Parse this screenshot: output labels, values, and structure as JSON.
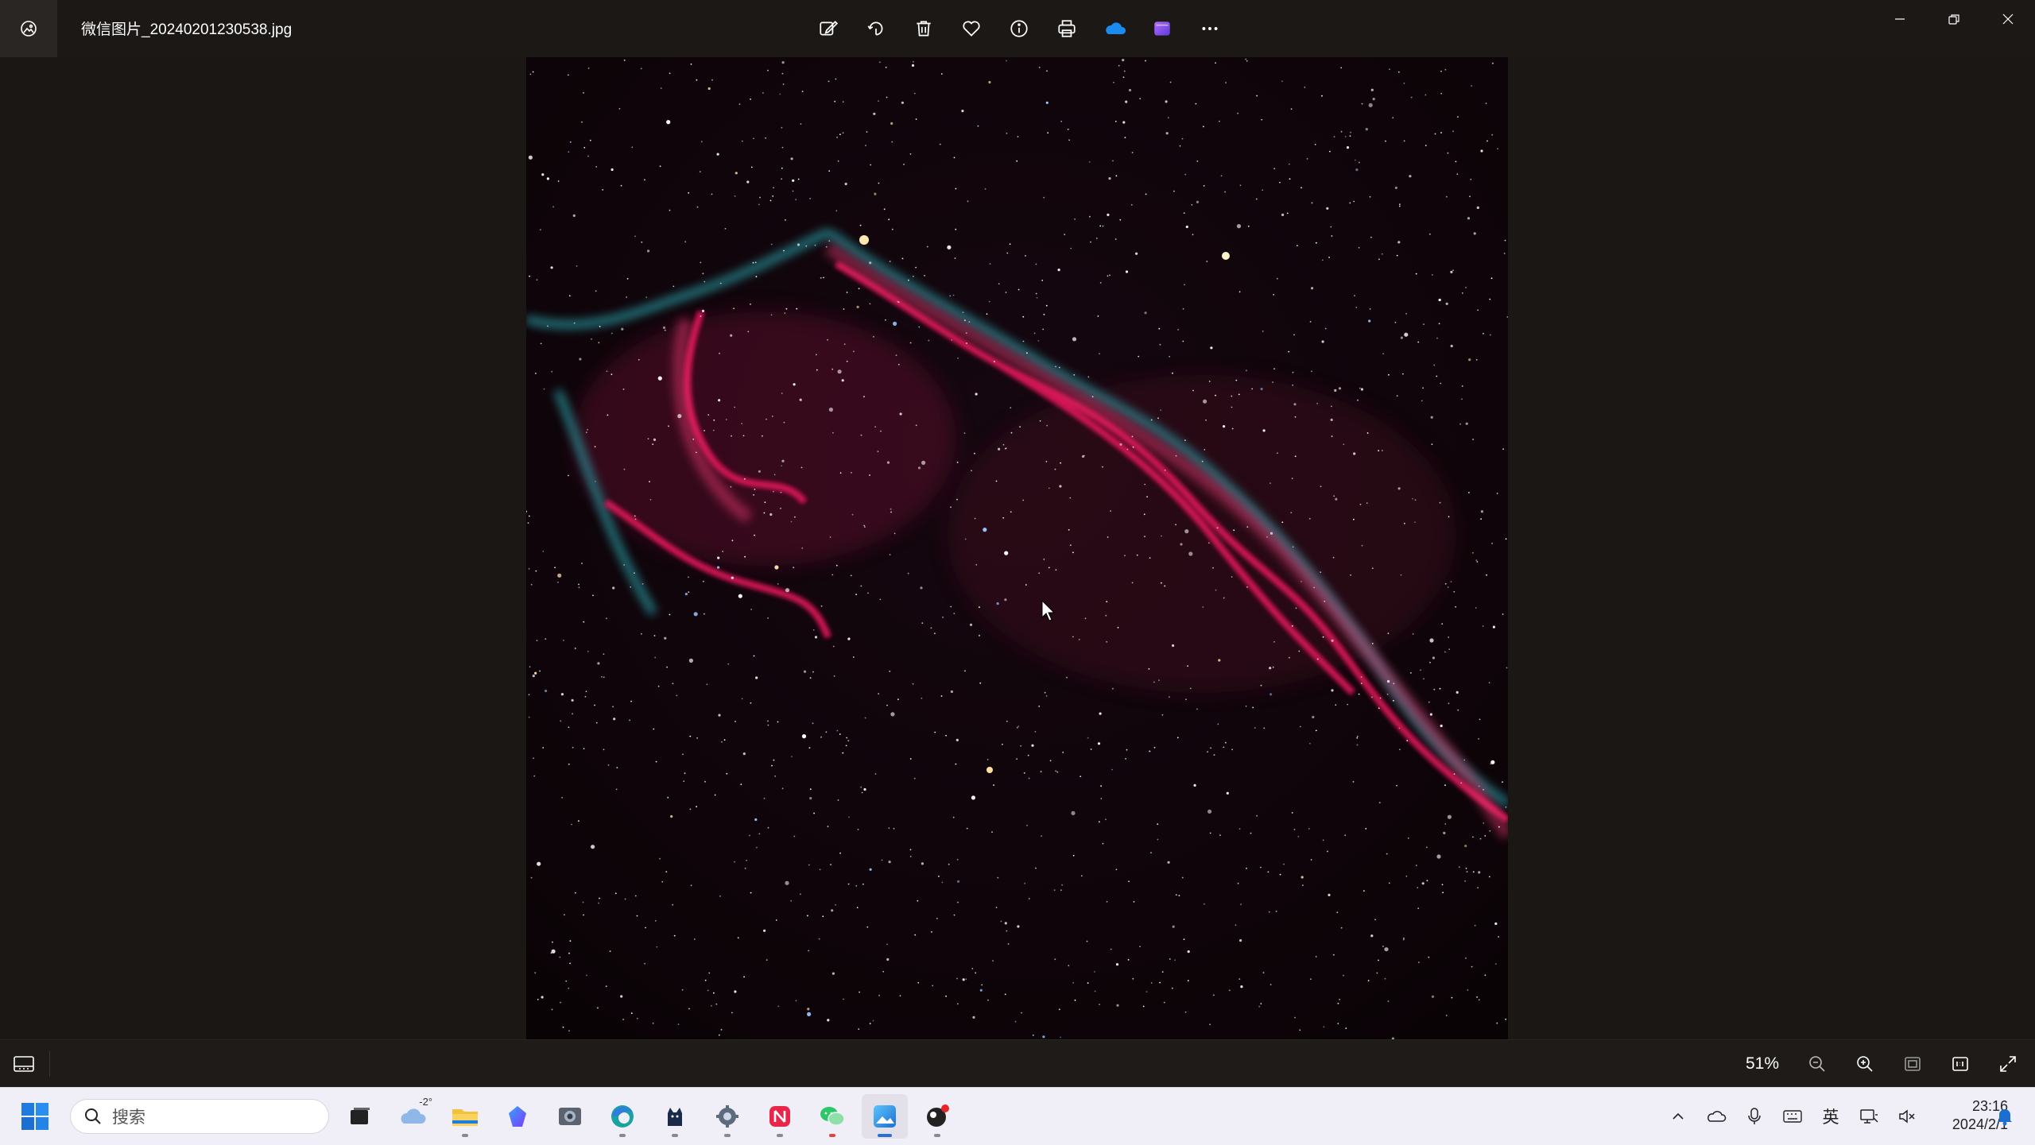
{
  "window": {
    "title": "微信图片_20240201230538.jpg"
  },
  "toolbar": {
    "buttons": [
      {
        "icon": "edit-image-icon",
        "tooltip": "Edit image"
      },
      {
        "icon": "rotate-icon",
        "tooltip": "Rotate"
      },
      {
        "icon": "delete-icon",
        "tooltip": "Delete"
      },
      {
        "icon": "favorite-heart-icon",
        "tooltip": "Add to favorites"
      },
      {
        "icon": "file-info-icon",
        "tooltip": "File information"
      },
      {
        "icon": "print-icon",
        "tooltip": "Print"
      },
      {
        "icon": "onedrive-cloud-icon",
        "tooltip": "OneDrive"
      },
      {
        "icon": "clipchamp-icon",
        "tooltip": "Clipchamp"
      },
      {
        "icon": "more-options-icon",
        "tooltip": "See more"
      }
    ]
  },
  "window_controls": [
    "minimize-icon",
    "restore-icon",
    "close-icon"
  ],
  "statusbar": {
    "zoom": "51%",
    "buttons": [
      "zoom-out-icon",
      "zoom-in-icon",
      "fit-to-window-icon",
      "actual-size-icon",
      "fullscreen-icon"
    ]
  },
  "taskbar": {
    "search_placeholder": "搜索",
    "weather_temp": "-2°",
    "apps": [
      {
        "name": "task-view",
        "icon": "task-view-icon"
      },
      {
        "name": "weather",
        "icon": "weather-cloud-icon"
      },
      {
        "name": "file-explorer",
        "icon": "folder-icon"
      },
      {
        "name": "copilot",
        "icon": "copilot-icon"
      },
      {
        "name": "photos-app",
        "icon": "camera-app-icon"
      },
      {
        "name": "edge",
        "icon": "edge-browser-icon"
      },
      {
        "name": "cat-app",
        "icon": "cat-app-icon"
      },
      {
        "name": "settings",
        "icon": "gear-icon"
      },
      {
        "name": "red-app",
        "icon": "red-app-icon"
      },
      {
        "name": "wechat",
        "icon": "wechat-icon"
      },
      {
        "name": "photos",
        "icon": "photos-icon"
      },
      {
        "name": "record-app",
        "icon": "record-app-icon"
      }
    ],
    "tray": {
      "language": "英",
      "time": "23:16",
      "date": "2024/2/1"
    }
  },
  "colors": {
    "titlebar_bg": "#1b1816",
    "canvas_bg": "#1a1714",
    "taskbar_bg": "#f0eef6",
    "accent": "#2a6fd6"
  }
}
